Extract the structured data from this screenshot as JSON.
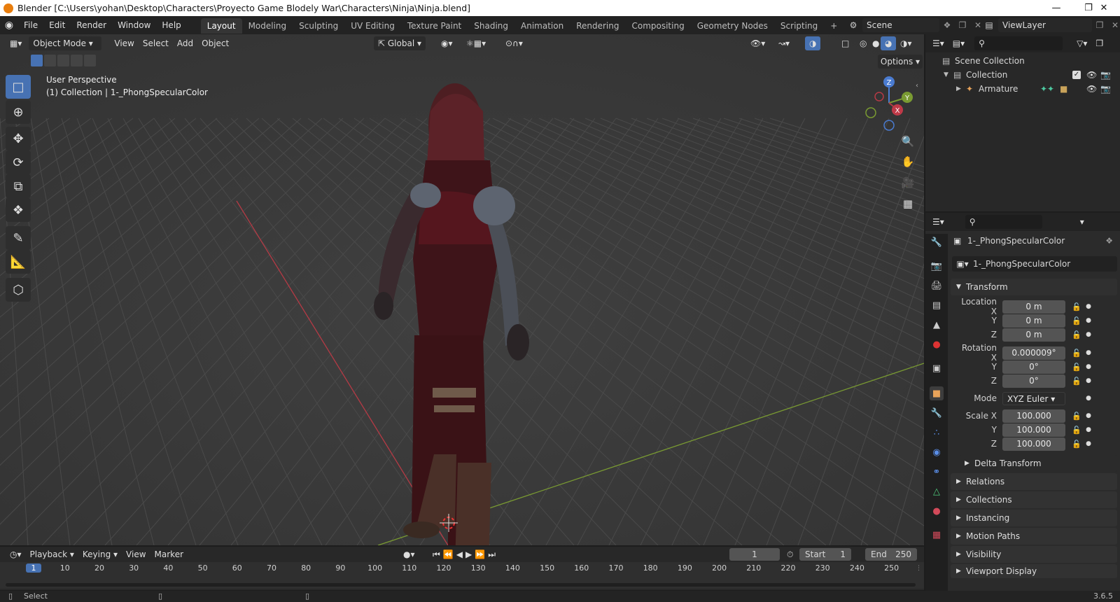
{
  "window": {
    "title": "Blender [C:\\Users\\yohan\\Desktop\\Characters\\Proyecto Game Blodely War\\Characters\\Ninja\\Ninja.blend]"
  },
  "menu": [
    "File",
    "Edit",
    "Render",
    "Window",
    "Help"
  ],
  "workspaces": [
    "Layout",
    "Modeling",
    "Sculpting",
    "UV Editing",
    "Texture Paint",
    "Shading",
    "Animation",
    "Rendering",
    "Compositing",
    "Geometry Nodes",
    "Scripting"
  ],
  "scene": {
    "name": "Scene",
    "view_layer": "ViewLayer"
  },
  "viewport": {
    "mode": "Object Mode",
    "menus": [
      "View",
      "Select",
      "Add",
      "Object"
    ],
    "orientation": "Global",
    "options": "Options",
    "overlay_title": "User Perspective",
    "overlay_sub": "(1) Collection | 1-_PhongSpecularColor",
    "gizmo": {
      "x": "X",
      "y": "Y",
      "z": "Z"
    }
  },
  "outliner": {
    "root": "Scene Collection",
    "collection": "Collection",
    "object": "Armature"
  },
  "properties": {
    "object_name": "1-_PhongSpecularColor",
    "datablock": "1-_PhongSpecularColor",
    "transform_label": "Transform",
    "location": {
      "label": "Location X",
      "x": "0 m",
      "y": "0 m",
      "z": "0 m"
    },
    "rotation": {
      "label": "Rotation X",
      "x": "0.000009°",
      "y": "0°",
      "z": "0°"
    },
    "mode": {
      "label": "Mode",
      "value": "XYZ Euler"
    },
    "scale": {
      "label": "Scale X",
      "x": "100.000",
      "y": "100.000",
      "z": "100.000"
    },
    "axis_y": "Y",
    "axis_z": "Z",
    "sections": [
      "Delta Transform",
      "Relations",
      "Collections",
      "Instancing",
      "Motion Paths",
      "Visibility",
      "Viewport Display"
    ]
  },
  "timeline": {
    "menus": [
      "Playback",
      "Keying",
      "View",
      "Marker"
    ],
    "current_frame": "1",
    "start_label": "Start",
    "start": "1",
    "end_label": "End",
    "end": "250",
    "ticks": [
      "1",
      "10",
      "20",
      "30",
      "40",
      "50",
      "60",
      "70",
      "80",
      "90",
      "100",
      "110",
      "120",
      "130",
      "140",
      "150",
      "160",
      "170",
      "180",
      "190",
      "200",
      "210",
      "220",
      "230",
      "240",
      "250"
    ]
  },
  "status": {
    "left": "Select",
    "version": "3.6.5"
  },
  "colors": {
    "accent": "#4772b3",
    "x_axis": "#b53a45",
    "y_axis": "#7a9b32"
  }
}
